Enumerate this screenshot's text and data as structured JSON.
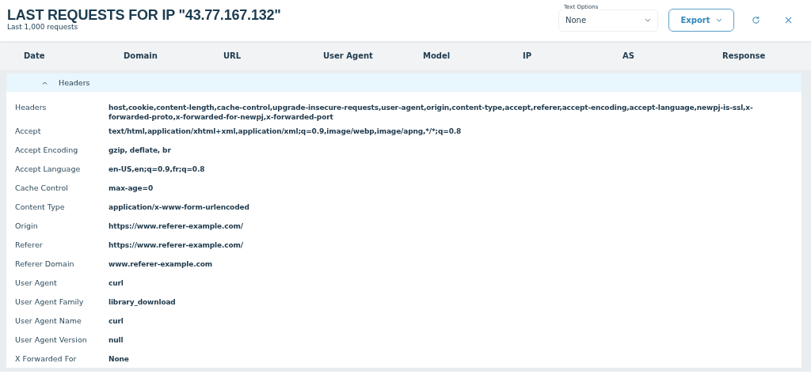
{
  "header": {
    "title": "LAST REQUESTS FOR IP \"43.77.167.132\"",
    "subtitle": "Last 1,000 requests"
  },
  "text_options": {
    "label": "Text Options",
    "value": "None"
  },
  "export_button": {
    "label": "Export"
  },
  "table": {
    "columns": [
      "Date",
      "Domain",
      "URL",
      "User Agent",
      "Model",
      "IP",
      "AS",
      "Response"
    ]
  },
  "section": {
    "title": "Headers",
    "expanded": true,
    "rows": [
      {
        "label": "Headers",
        "value": "host,cookie,content-length,cache-control,upgrade-insecure-requests,user-agent,origin,content-type,accept,referer,accept-encoding,accept-language,newpj-is-ssl,x-forwarded-proto,x-forwarded-for-newpj,x-forwarded-port"
      },
      {
        "label": "Accept",
        "value": "text/html,application/xhtml+xml,application/xml;q=0.9,image/webp,image/apng,*/*;q=0.8"
      },
      {
        "label": "Accept Encoding",
        "value": "gzip, deflate, br"
      },
      {
        "label": "Accept Language",
        "value": "en-US,en;q=0.9,fr;q=0.8"
      },
      {
        "label": "Cache Control",
        "value": "max-age=0"
      },
      {
        "label": "Content Type",
        "value": "application/x-www-form-urlencoded"
      },
      {
        "label": "Origin",
        "value": "https://www.referer-example.com/"
      },
      {
        "label": "Referer",
        "value": "https://www.referer-example.com/"
      },
      {
        "label": "Referer Domain",
        "value": "www.referer-example.com"
      },
      {
        "label": "User Agent",
        "value": "curl"
      },
      {
        "label": "User Agent Family",
        "value": "library_download"
      },
      {
        "label": "User Agent Name",
        "value": "curl"
      },
      {
        "label": "User Agent Version",
        "value": "null"
      },
      {
        "label": "X Forwarded For",
        "value": "None"
      }
    ]
  }
}
